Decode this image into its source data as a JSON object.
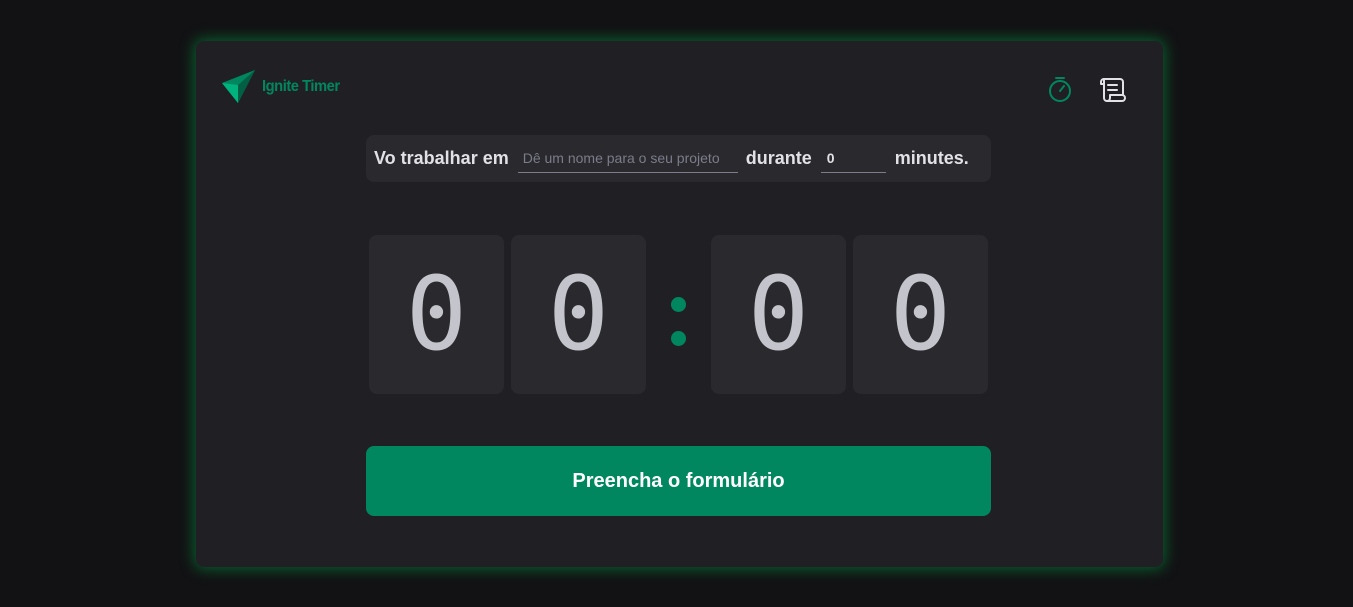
{
  "app": {
    "logo_text": "Ignite Timer"
  },
  "nav": {
    "items": [
      {
        "icon": "timer-icon",
        "active": true
      },
      {
        "icon": "history-scroll-icon",
        "active": false
      }
    ]
  },
  "form": {
    "task_label": "Vo trabalhar em",
    "task_value": "",
    "task_placeholder": "Dê um nome para o seu projeto",
    "duration_label": "durante",
    "minutes_value": "0",
    "minutes_suffix": "minutes."
  },
  "countdown": {
    "minutes_tens": "0",
    "minutes_ones": "0",
    "separator": ":",
    "seconds_tens": "0",
    "seconds_ones": "0"
  },
  "start_button": {
    "label": "Preencha o formulário"
  },
  "colors": {
    "background": "#121214",
    "card": "#202024",
    "accent": "#00875f",
    "digit_bg": "#29292e",
    "digit_text": "#c4c4cc"
  }
}
